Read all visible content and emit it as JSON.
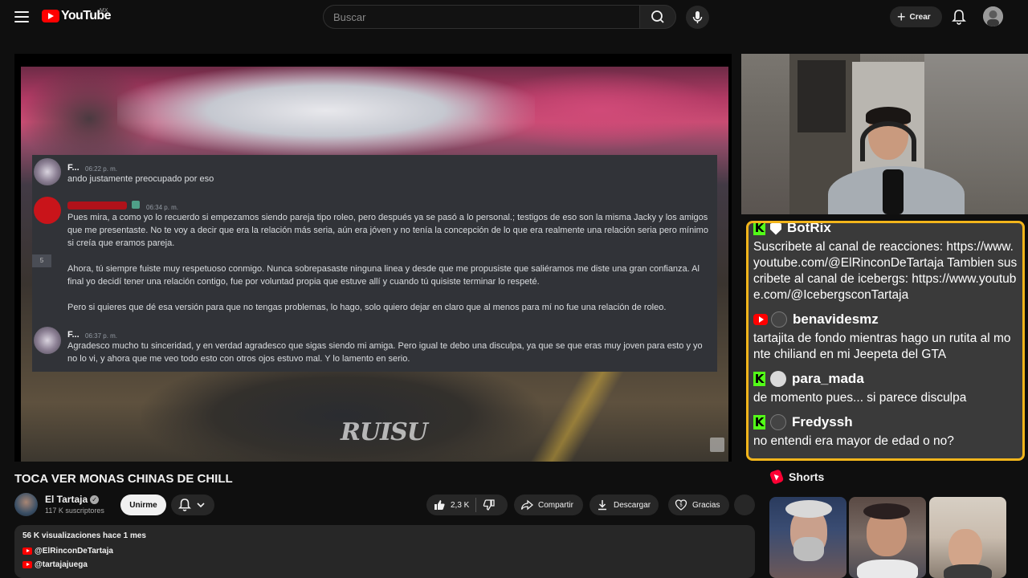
{
  "header": {
    "logo_text": "YouTube",
    "country_code": "MX",
    "search_placeholder": "Buscar",
    "create_label": "Crear"
  },
  "video": {
    "chat_screenshot": {
      "messages": [
        {
          "author": "F...",
          "time": "06:22 p. m.",
          "lines": [
            "ando justamente preocupado por eso"
          ]
        },
        {
          "author": "",
          "time": "06:34 p. m.",
          "lines": [
            "Pues mira, a como yo lo recuerdo si empezamos siendo pareja tipo roleo, pero después ya se pasó a lo personal.; testigos de eso son la misma Jacky y los amigos que me presentaste. No te voy a decir que era la relación más seria, aún era jóven y no tenía la concepción de lo que era realmente una relación seria pero mínimo si creía que eramos pareja.",
            "Ahora, tú siempre fuiste muy respetuoso conmigo. Nunca sobrepasaste ninguna linea y desde que me propusiste que saliéramos me diste una gran confianza. Al final yo decidí tener una relación contigo, fue por voluntad propia que estuve allí y cuando tú quisiste terminar lo respeté.",
            "Pero si quieres que dé esa versión para que no tengas problemas, lo hago, solo quiero dejar en claro que al menos para mí no fue una relación de roleo."
          ]
        },
        {
          "author": "F...",
          "time": "06:37 p. m.",
          "lines": [
            "Agradesco mucho tu sinceridad, y en verdad agradesco que sigas siendo mi amiga. Pero igual te debo una disculpa, ya que se que eras muy joven para esto y yo no lo vi, y ahora que me veo todo esto con otros ojos estuvo mal. Y lo lamento en serio."
          ]
        }
      ],
      "side_label": "5"
    },
    "watermark": "RUISU"
  },
  "live_chat": {
    "border_color": "#f2b51b",
    "messages": [
      {
        "platform": "kick",
        "user": "BotRix",
        "text": "Suscribete al canal de reacciones: https://www.youtube.com/@ElRinconDeTartaja Tambien suscribete al canal de icebergs: https://www.youtube.com/@IcebergsconTartaja"
      },
      {
        "platform": "youtube",
        "user": "benavidesmz",
        "text": "tartajita de fondo mientras hago un rutita al monte chiliand en mi Jeepeta del GTA"
      },
      {
        "platform": "kick",
        "user": "para_mada",
        "text": "de momento pues... si parece disculpa"
      },
      {
        "platform": "kick",
        "user": "Fredyssh",
        "text": "no entendi era mayor de edad o no?"
      }
    ]
  },
  "meta": {
    "title": "TOCA VER MONAS CHINAS DE CHILL",
    "channel_name": "El Tartaja",
    "subscribers": "117 K suscriptores",
    "join_label": "Unirme",
    "likes": "2,3 K",
    "share_label": "Compartir",
    "download_label": "Descargar",
    "thanks_label": "Gracias"
  },
  "description": {
    "stats": "56 K visualizaciones  hace 1 mes",
    "links": [
      "@ElRinconDeTartaja",
      "@tartajajuega"
    ]
  },
  "shorts": {
    "heading": "Shorts"
  }
}
